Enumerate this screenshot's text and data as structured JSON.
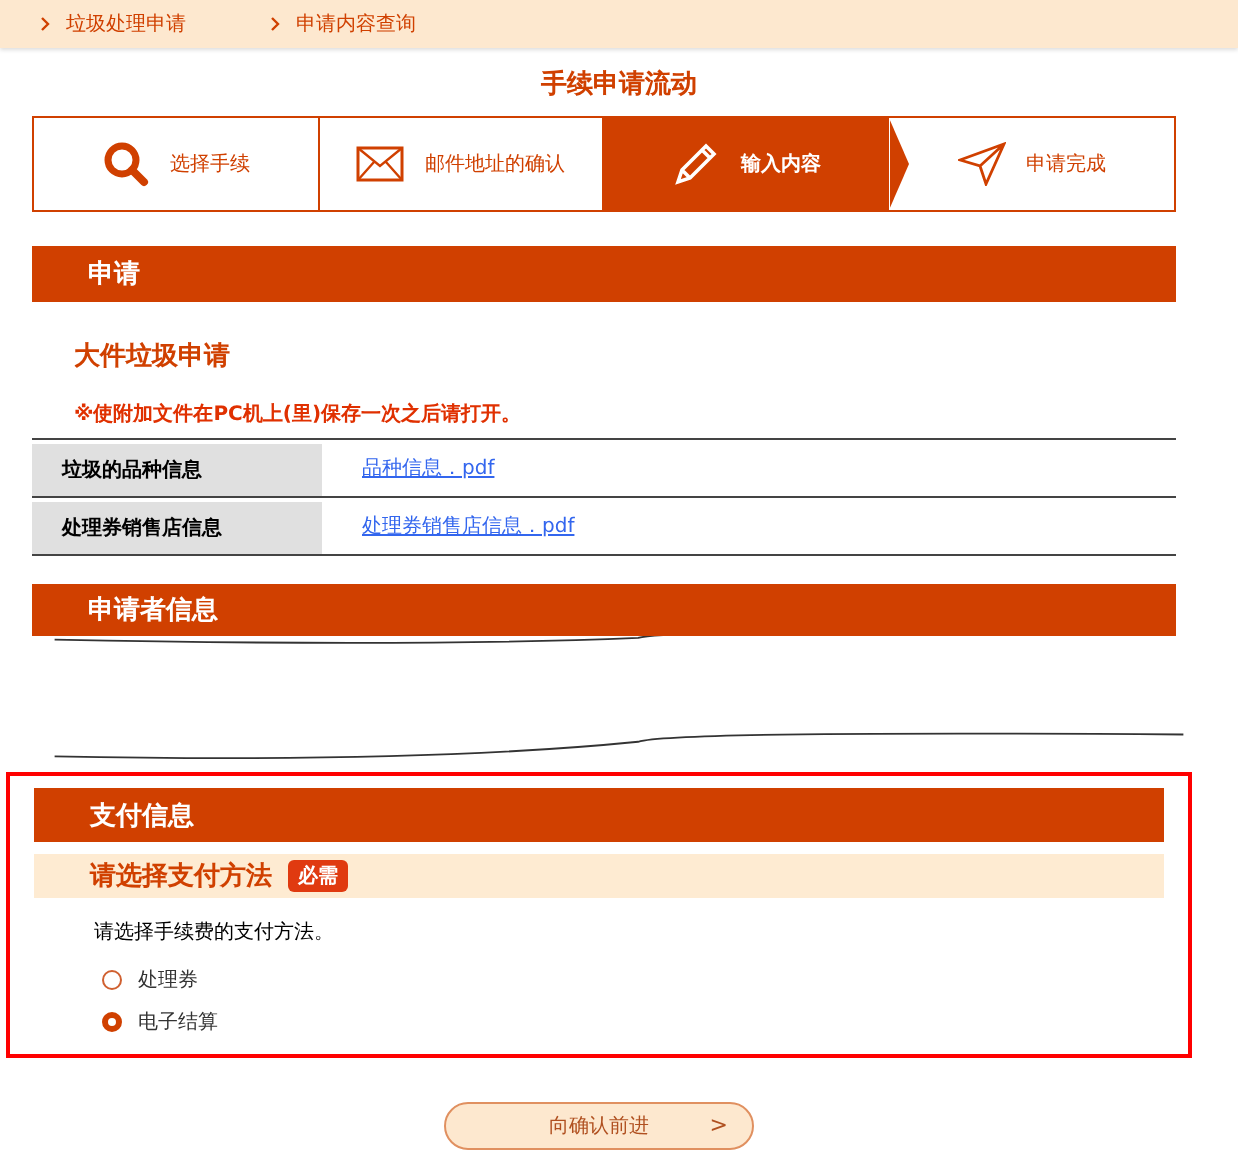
{
  "breadcrumbs": [
    {
      "label": "垃圾处理申请"
    },
    {
      "label": "申请内容查询"
    }
  ],
  "flow_title": "手续申请流动",
  "steps": [
    {
      "label": "选择手续",
      "kind": "search",
      "selected": false
    },
    {
      "label": "邮件地址的确认",
      "kind": "mail",
      "selected": false
    },
    {
      "label": "输入内容",
      "kind": "pencil",
      "selected": true
    },
    {
      "label": "申请完成",
      "kind": "send",
      "selected": false
    }
  ],
  "application": {
    "header": "申请",
    "subtitle": "大件垃圾申请",
    "notice": "※使附加文件在PC机上(里)保存一次之后请打开。",
    "rows": [
      {
        "label": "垃圾的品种信息",
        "link": "品种信息．pdf"
      },
      {
        "label": "处理券销售店信息",
        "link": "处理券销售店信息．pdf"
      }
    ]
  },
  "applicant": {
    "header": "申请者信息"
  },
  "payment": {
    "header": "支付信息",
    "question": "请选择支付方法",
    "required_badge": "必需",
    "instruction": "请选择手续费的支付方法。",
    "options": [
      {
        "label": "处理券",
        "selected": false
      },
      {
        "label": "电子结算",
        "selected": true
      }
    ]
  },
  "next_button": {
    "label": "向确认前进",
    "arrow": ">"
  }
}
